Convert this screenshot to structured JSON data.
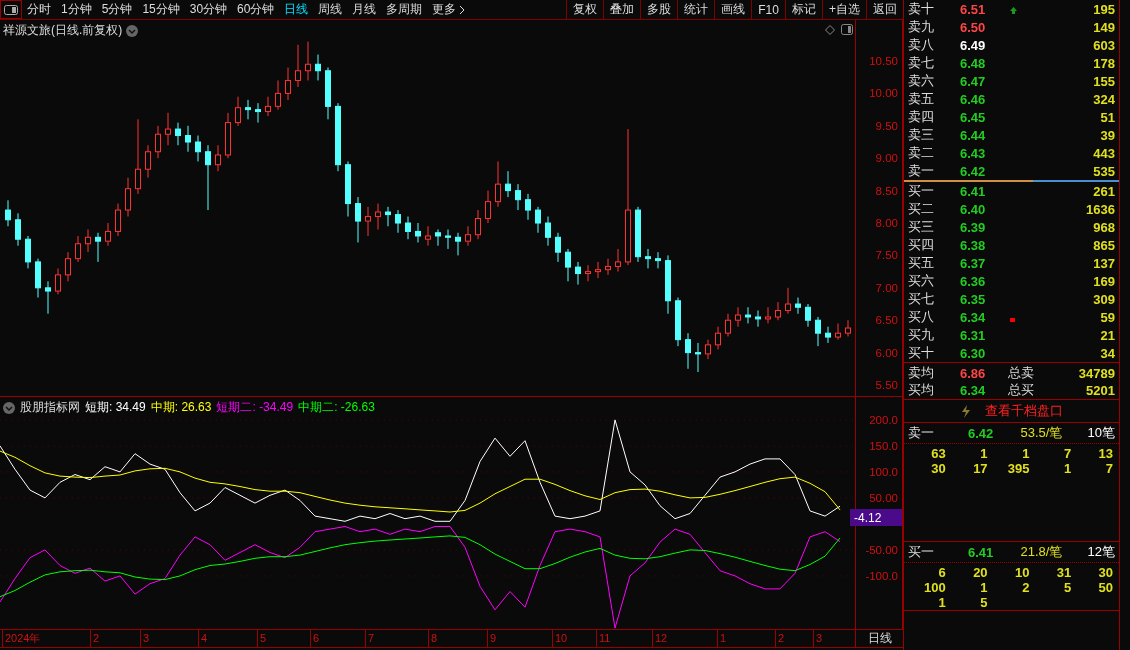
{
  "toolbar": {
    "periods": [
      {
        "label": "分时",
        "selected": false
      },
      {
        "label": "1分钟",
        "selected": false
      },
      {
        "label": "5分钟",
        "selected": false
      },
      {
        "label": "15分钟",
        "selected": false
      },
      {
        "label": "30分钟",
        "selected": false
      },
      {
        "label": "60分钟",
        "selected": false
      },
      {
        "label": "日线",
        "selected": true
      },
      {
        "label": "周线",
        "selected": false
      },
      {
        "label": "月线",
        "selected": false
      },
      {
        "label": "多周期",
        "selected": false
      }
    ],
    "more": "更多",
    "actions": [
      "复权",
      "叠加",
      "多股",
      "统计",
      "画线",
      "F10",
      "标记",
      "+自选",
      "返回"
    ]
  },
  "chart": {
    "title": "祥源文旅(日线.前复权)",
    "chart_data": {
      "type": "candlestick",
      "ylim": [
        5.346,
        11.133
      ],
      "yticks": [
        {
          "value": 10.5,
          "label": "10.50"
        },
        {
          "value": 10,
          "label": "10.00"
        },
        {
          "value": 9.5,
          "label": "9.50"
        },
        {
          "value": 9,
          "label": "9.00"
        },
        {
          "value": 8.5,
          "label": "8.50"
        },
        {
          "value": 8,
          "label": "8.00"
        },
        {
          "value": 7.5,
          "label": "7.50"
        },
        {
          "value": 7,
          "label": "7.00"
        },
        {
          "value": 6.5,
          "label": "6.50"
        },
        {
          "value": 6,
          "label": "6.00"
        },
        {
          "value": 5.5,
          "label": "5.50"
        }
      ],
      "ohlc": [
        [
          8.2,
          8.35,
          7.95,
          8.05
        ],
        [
          8.05,
          8.15,
          7.65,
          7.75
        ],
        [
          7.75,
          7.8,
          7.3,
          7.4
        ],
        [
          7.4,
          7.45,
          6.85,
          7.0
        ],
        [
          7.0,
          7.1,
          6.6,
          6.95
        ],
        [
          6.95,
          7.3,
          6.9,
          7.2
        ],
        [
          7.2,
          7.55,
          7.1,
          7.45
        ],
        [
          7.45,
          7.8,
          7.4,
          7.68
        ],
        [
          7.68,
          7.9,
          7.55,
          7.78
        ],
        [
          7.78,
          7.85,
          7.4,
          7.72
        ],
        [
          7.72,
          8.0,
          7.65,
          7.87
        ],
        [
          7.87,
          8.3,
          7.8,
          8.2
        ],
        [
          8.2,
          8.7,
          8.1,
          8.53
        ],
        [
          8.53,
          9.6,
          8.45,
          8.83
        ],
        [
          8.83,
          9.2,
          8.7,
          9.1
        ],
        [
          9.1,
          9.5,
          9.0,
          9.37
        ],
        [
          9.37,
          9.7,
          9.2,
          9.45
        ],
        [
          9.45,
          9.55,
          9.2,
          9.35
        ],
        [
          9.35,
          9.5,
          9.1,
          9.25
        ],
        [
          9.25,
          9.35,
          8.95,
          9.1
        ],
        [
          9.1,
          9.2,
          8.2,
          8.9
        ],
        [
          8.9,
          9.2,
          8.8,
          9.05
        ],
        [
          9.05,
          9.7,
          9.0,
          9.55
        ],
        [
          9.55,
          9.95,
          9.5,
          9.78
        ],
        [
          9.78,
          9.9,
          9.6,
          9.75
        ],
        [
          9.75,
          9.85,
          9.55,
          9.72
        ],
        [
          9.72,
          9.95,
          9.65,
          9.8
        ],
        [
          9.8,
          10.2,
          9.75,
          10.0
        ],
        [
          10.0,
          10.4,
          9.9,
          10.2
        ],
        [
          10.2,
          10.75,
          10.1,
          10.35
        ],
        [
          10.35,
          10.8,
          10.2,
          10.45
        ],
        [
          10.45,
          10.6,
          10.2,
          10.35
        ],
        [
          10.35,
          10.4,
          9.6,
          9.8
        ],
        [
          9.8,
          9.85,
          8.8,
          8.9
        ],
        [
          8.9,
          8.95,
          8.1,
          8.3
        ],
        [
          8.3,
          8.4,
          7.7,
          8.03
        ],
        [
          8.03,
          8.25,
          7.8,
          8.1
        ],
        [
          8.1,
          8.3,
          7.9,
          8.17
        ],
        [
          8.17,
          8.25,
          7.95,
          8.13
        ],
        [
          8.13,
          8.2,
          7.85,
          8.0
        ],
        [
          8.0,
          8.1,
          7.75,
          7.87
        ],
        [
          7.87,
          8.0,
          7.7,
          7.8
        ],
        [
          7.75,
          7.95,
          7.65,
          7.8
        ],
        [
          7.85,
          7.9,
          7.65,
          7.8
        ],
        [
          7.8,
          7.9,
          7.6,
          7.78
        ],
        [
          7.78,
          7.85,
          7.5,
          7.72
        ],
        [
          7.72,
          7.95,
          7.65,
          7.82
        ],
        [
          7.82,
          8.2,
          7.75,
          8.07
        ],
        [
          8.07,
          8.5,
          8.0,
          8.33
        ],
        [
          8.33,
          8.95,
          8.25,
          8.6
        ],
        [
          8.6,
          8.8,
          8.4,
          8.5
        ],
        [
          8.5,
          8.6,
          8.2,
          8.36
        ],
        [
          8.36,
          8.45,
          8.05,
          8.2
        ],
        [
          8.2,
          8.25,
          7.85,
          8.0
        ],
        [
          8.0,
          8.1,
          7.65,
          7.78
        ],
        [
          7.78,
          7.85,
          7.4,
          7.55
        ],
        [
          7.55,
          7.6,
          7.1,
          7.32
        ],
        [
          7.32,
          7.4,
          7.05,
          7.22
        ],
        [
          7.22,
          7.35,
          7.1,
          7.25
        ],
        [
          7.25,
          7.4,
          7.15,
          7.28
        ],
        [
          7.28,
          7.45,
          7.2,
          7.33
        ],
        [
          7.33,
          7.6,
          7.25,
          7.4
        ],
        [
          7.4,
          9.45,
          7.35,
          8.2
        ],
        [
          8.2,
          8.25,
          7.4,
          7.48
        ],
        [
          7.48,
          7.6,
          7.3,
          7.45
        ],
        [
          7.45,
          7.55,
          7.3,
          7.42
        ],
        [
          7.42,
          7.5,
          6.6,
          6.8
        ],
        [
          6.8,
          6.85,
          6.1,
          6.2
        ],
        [
          6.2,
          6.3,
          5.75,
          6.0
        ],
        [
          6.0,
          6.15,
          5.7,
          5.98
        ],
        [
          5.98,
          6.2,
          5.9,
          6.12
        ],
        [
          6.12,
          6.4,
          6.05,
          6.3
        ],
        [
          6.3,
          6.6,
          6.25,
          6.5
        ],
        [
          6.5,
          6.7,
          6.4,
          6.58
        ],
        [
          6.58,
          6.7,
          6.45,
          6.55
        ],
        [
          6.55,
          6.65,
          6.4,
          6.52
        ],
        [
          6.52,
          6.7,
          6.45,
          6.55
        ],
        [
          6.55,
          6.78,
          6.5,
          6.65
        ],
        [
          6.65,
          7.0,
          6.6,
          6.75
        ],
        [
          6.75,
          6.85,
          6.6,
          6.7
        ],
        [
          6.7,
          6.75,
          6.4,
          6.5
        ],
        [
          6.5,
          6.55,
          6.1,
          6.3
        ],
        [
          6.3,
          6.4,
          6.15,
          6.24
        ],
        [
          6.24,
          6.45,
          6.2,
          6.3
        ],
        [
          6.3,
          6.5,
          6.25,
          6.38
        ]
      ]
    }
  },
  "indicator": {
    "name": "股朋指标网",
    "values": [
      {
        "label": "短期:",
        "value": "34.49",
        "color": "#ffffff"
      },
      {
        "label": "中期:",
        "value": "26.63",
        "color": "#ffff00"
      },
      {
        "label": "短期二:",
        "value": "-34.49",
        "color": "#ff00ff"
      },
      {
        "label": "中期二:",
        "value": "-26.63",
        "color": "#00ff00"
      }
    ],
    "chart_data": {
      "type": "line",
      "grid": true,
      "ylim": [
        -202,
        244
      ],
      "yticks": [
        {
          "value": 200,
          "label": "200.0"
        },
        {
          "value": 150,
          "label": "150.0"
        },
        {
          "value": 100,
          "label": "100.0"
        },
        {
          "value": 50,
          "label": "50.00"
        },
        {
          "value": -50,
          "label": "-50.00"
        },
        {
          "value": -100,
          "label": "-100.0"
        }
      ],
      "series": [
        {
          "color": "#ffffff",
          "values": [
            150,
            105,
            65,
            50,
            80,
            95,
            85,
            110,
            100,
            135,
            115,
            105,
            60,
            25,
            40,
            70,
            55,
            40,
            55,
            65,
            45,
            15,
            10,
            5,
            15,
            10,
            20,
            10,
            15,
            5,
            5,
            45,
            120,
            165,
            130,
            160,
            80,
            15,
            10,
            15,
            25,
            200,
            100,
            75,
            35,
            10,
            20,
            55,
            90,
            100,
            115,
            125,
            125,
            95,
            25,
            15,
            34
          ]
        },
        {
          "color": "#ffff00",
          "values": [
            140,
            128,
            112,
            98,
            92,
            90,
            89,
            92,
            94,
            102,
            106,
            107,
            100,
            88,
            80,
            77,
            72,
            66,
            63,
            63,
            60,
            53,
            46,
            40,
            36,
            33,
            31,
            29,
            27,
            25,
            23,
            26,
            40,
            58,
            72,
            86,
            86,
            76,
            64,
            54,
            47,
            60,
            66,
            67,
            63,
            56,
            50,
            51,
            57,
            64,
            72,
            80,
            87,
            90,
            78,
            62,
            27
          ]
        },
        {
          "color": "#ff00ff",
          "values": [
            -150,
            -105,
            -65,
            -50,
            -80,
            -95,
            -85,
            -110,
            -100,
            -135,
            -115,
            -105,
            -60,
            -25,
            -40,
            -70,
            -55,
            -40,
            -55,
            -65,
            -45,
            -15,
            -10,
            -5,
            -15,
            -10,
            -20,
            -10,
            -15,
            -5,
            -5,
            -45,
            -120,
            -165,
            -130,
            -160,
            -80,
            -15,
            -10,
            -15,
            -25,
            -200,
            -100,
            -75,
            -35,
            -10,
            -20,
            -55,
            -90,
            -100,
            -115,
            -125,
            -125,
            -95,
            -25,
            -15,
            -34
          ]
        },
        {
          "color": "#00ff00",
          "values": [
            -140,
            -128,
            -112,
            -98,
            -92,
            -90,
            -89,
            -92,
            -94,
            -102,
            -106,
            -107,
            -100,
            -88,
            -80,
            -77,
            -72,
            -66,
            -63,
            -63,
            -60,
            -53,
            -46,
            -40,
            -36,
            -33,
            -31,
            -29,
            -27,
            -25,
            -23,
            -26,
            -40,
            -58,
            -72,
            -86,
            -86,
            -76,
            -64,
            -54,
            -47,
            -60,
            -66,
            -67,
            -63,
            -56,
            -50,
            -51,
            -57,
            -64,
            -72,
            -80,
            -87,
            -90,
            -78,
            -62,
            -27
          ]
        }
      ]
    },
    "current": "-4.12"
  },
  "time_axis": {
    "labels": [
      "2024年",
      "2",
      "3",
      "4",
      "5",
      "6",
      "7",
      "8",
      "9",
      "10",
      "11",
      "12",
      "1",
      "2",
      "3"
    ],
    "period": "日线"
  },
  "order_book": {
    "asks": [
      {
        "label": "卖十",
        "price": "6.51",
        "color": "#ff4444",
        "volume": "195",
        "up_arrow": true,
        "marked": false
      },
      {
        "label": "卖九",
        "price": "6.50",
        "color": "#ff4444",
        "volume": "149",
        "up_arrow": false,
        "marked": false
      },
      {
        "label": "卖八",
        "price": "6.49",
        "color": "#ffffff",
        "volume": "603",
        "up_arrow": false,
        "marked": false
      },
      {
        "label": "卖七",
        "price": "6.48",
        "color": "#22cc22",
        "volume": "178",
        "up_arrow": false,
        "marked": false
      },
      {
        "label": "卖六",
        "price": "6.47",
        "color": "#22cc22",
        "volume": "155",
        "up_arrow": false,
        "marked": false
      },
      {
        "label": "卖五",
        "price": "6.46",
        "color": "#22cc22",
        "volume": "324",
        "up_arrow": false,
        "marked": false
      },
      {
        "label": "卖四",
        "price": "6.45",
        "color": "#22cc22",
        "volume": "51",
        "up_arrow": false,
        "marked": false
      },
      {
        "label": "卖三",
        "price": "6.44",
        "color": "#22cc22",
        "volume": "39",
        "up_arrow": false,
        "marked": false
      },
      {
        "label": "卖二",
        "price": "6.43",
        "color": "#22cc22",
        "volume": "443",
        "up_arrow": false,
        "marked": false
      },
      {
        "label": "卖一",
        "price": "6.42",
        "color": "#22cc22",
        "volume": "535",
        "up_arrow": false,
        "marked": false
      }
    ],
    "bids": [
      {
        "label": "买一",
        "price": "6.41",
        "color": "#22cc22",
        "volume": "261",
        "up_arrow": false,
        "marked": false
      },
      {
        "label": "买二",
        "price": "6.40",
        "color": "#22cc22",
        "volume": "1636",
        "up_arrow": false,
        "marked": false
      },
      {
        "label": "买三",
        "price": "6.39",
        "color": "#22cc22",
        "volume": "968",
        "up_arrow": false,
        "marked": false
      },
      {
        "label": "买四",
        "price": "6.38",
        "color": "#22cc22",
        "volume": "865",
        "up_arrow": false,
        "marked": false
      },
      {
        "label": "买五",
        "price": "6.37",
        "color": "#22cc22",
        "volume": "137",
        "up_arrow": false,
        "marked": false
      },
      {
        "label": "买六",
        "price": "6.36",
        "color": "#22cc22",
        "volume": "169",
        "up_arrow": false,
        "marked": false
      },
      {
        "label": "买七",
        "price": "6.35",
        "color": "#22cc22",
        "volume": "309",
        "up_arrow": false,
        "marked": false
      },
      {
        "label": "买八",
        "price": "6.34",
        "color": "#22cc22",
        "volume": "59",
        "up_arrow": false,
        "marked": true
      },
      {
        "label": "买九",
        "price": "6.31",
        "color": "#22cc22",
        "volume": "21",
        "up_arrow": false,
        "marked": false
      },
      {
        "label": "买十",
        "price": "6.30",
        "color": "#22cc22",
        "volume": "34",
        "up_arrow": false,
        "marked": false
      }
    ],
    "summary": [
      {
        "label": "卖均",
        "price": "6.86",
        "color": "#ff4444",
        "total_label": "总卖",
        "total": "34789"
      },
      {
        "label": "买均",
        "price": "6.34",
        "color": "#22cc22",
        "total_label": "总买",
        "total": "5201"
      }
    ],
    "depth_link": "查看千档盘口"
  },
  "queues": [
    {
      "label": "卖一",
      "price": "6.42",
      "average": "53.5/笔",
      "count": "10笔",
      "rows": [
        [
          "63",
          "1",
          "1",
          "7",
          "13"
        ],
        [
          "30",
          "17",
          "395",
          "1",
          "7"
        ]
      ]
    },
    {
      "label": "买一",
      "price": "6.41",
      "average": "21.8/笔",
      "count": "12笔",
      "rows": [
        [
          "6",
          "20",
          "10",
          "31",
          "30"
        ],
        [
          "100",
          "1",
          "2",
          "5",
          "50"
        ],
        [
          "1",
          "5"
        ]
      ]
    }
  ]
}
